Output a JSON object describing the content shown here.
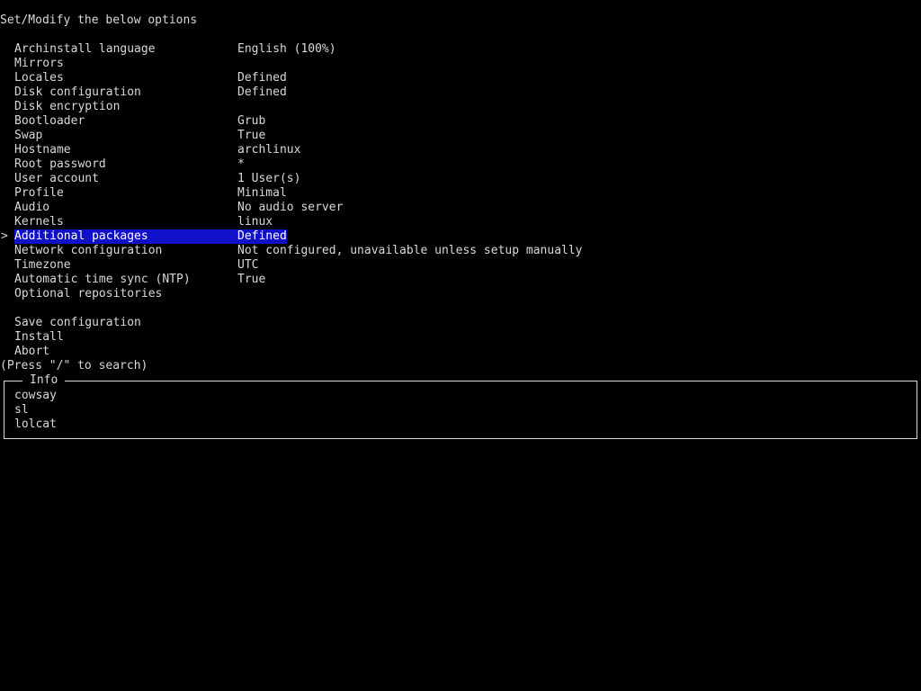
{
  "header": "Set/Modify the below options",
  "selected_pointer": ">",
  "menu": [
    {
      "label": "Archinstall language",
      "value": "English (100%)"
    },
    {
      "label": "Mirrors",
      "value": ""
    },
    {
      "label": "Locales",
      "value": "Defined"
    },
    {
      "label": "Disk configuration",
      "value": "Defined"
    },
    {
      "label": "Disk encryption",
      "value": ""
    },
    {
      "label": "Bootloader",
      "value": "Grub"
    },
    {
      "label": "Swap",
      "value": "True"
    },
    {
      "label": "Hostname",
      "value": "archlinux"
    },
    {
      "label": "Root password",
      "value": "*"
    },
    {
      "label": "User account",
      "value": "1 User(s)"
    },
    {
      "label": "Profile",
      "value": "Minimal"
    },
    {
      "label": "Audio",
      "value": "No audio server"
    },
    {
      "label": "Kernels",
      "value": "linux"
    },
    {
      "label": "Additional packages",
      "value": "Defined"
    },
    {
      "label": "Network configuration",
      "value": "Not configured, unavailable unless setup manually"
    },
    {
      "label": "Timezone",
      "value": "UTC"
    },
    {
      "label": "Automatic time sync (NTP)",
      "value": "True"
    },
    {
      "label": "Optional repositories",
      "value": ""
    },
    {
      "label": "",
      "value": ""
    },
    {
      "label": "Save configuration",
      "value": ""
    },
    {
      "label": "Install",
      "value": ""
    },
    {
      "label": "Abort",
      "value": ""
    }
  ],
  "selected_index": 13,
  "search_hint": "(Press \"/\" to search)",
  "info": {
    "title": "Info",
    "items": [
      "cowsay",
      "sl",
      "lolcat"
    ]
  },
  "colors": {
    "background": "#000000",
    "text": "#d8d8d8",
    "selection": "#1010c8"
  }
}
